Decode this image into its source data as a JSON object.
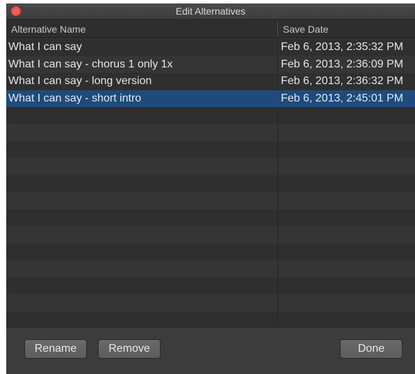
{
  "window": {
    "title": "Edit Alternatives"
  },
  "table": {
    "columns": {
      "name": "Alternative Name",
      "date": "Save Date"
    },
    "rows": [
      {
        "name": "What I can say",
        "date": "Feb 6, 2013, 2:35:32 PM",
        "selected": false
      },
      {
        "name": "What I can say - chorus 1 only 1x",
        "date": "Feb 6, 2013, 2:36:09 PM",
        "selected": false
      },
      {
        "name": "What I can say - long version",
        "date": "Feb 6, 2013, 2:36:32 PM",
        "selected": false
      },
      {
        "name": "What I can say - short intro",
        "date": "Feb 6, 2013, 2:45:01 PM",
        "selected": true
      }
    ]
  },
  "footer": {
    "rename_label": "Rename",
    "remove_label": "Remove",
    "done_label": "Done"
  },
  "colors": {
    "selection": "#1f4b7c",
    "close_button": "#ee5c55"
  },
  "icons": {
    "close": "close-icon"
  }
}
